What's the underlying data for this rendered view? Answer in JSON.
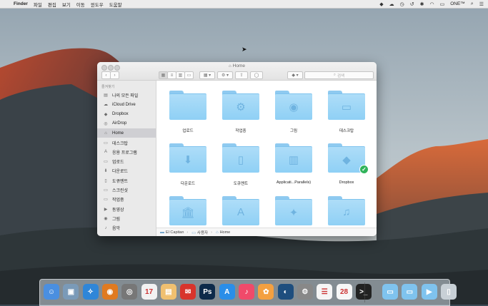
{
  "menubar": {
    "app_name": "Finder",
    "items": [
      "파일",
      "편집",
      "보기",
      "이동",
      "윈도우",
      "도움말"
    ],
    "right_label": "ONE™"
  },
  "window": {
    "title": "Home",
    "search_placeholder": "검색"
  },
  "sidebar": {
    "header": "즐겨찾기",
    "items": [
      {
        "label": "나의 모든 파일",
        "icon": "all-files-icon"
      },
      {
        "label": "iCloud Drive",
        "icon": "cloud-icon"
      },
      {
        "label": "Dropbox",
        "icon": "dropbox-icon"
      },
      {
        "label": "AirDrop",
        "icon": "airdrop-icon"
      },
      {
        "label": "Home",
        "icon": "home-icon",
        "selected": true
      },
      {
        "label": "데스크탑",
        "icon": "desktop-icon"
      },
      {
        "label": "응용 프로그램",
        "icon": "applications-icon"
      },
      {
        "label": "업로드",
        "icon": "folder-icon"
      },
      {
        "label": "다운로드",
        "icon": "download-icon"
      },
      {
        "label": "도큐멘트",
        "icon": "documents-icon"
      },
      {
        "label": "스크린샷",
        "icon": "folder-icon"
      },
      {
        "label": "작업중",
        "icon": "folder-icon"
      },
      {
        "label": "동영상",
        "icon": "movies-icon"
      },
      {
        "label": "그림",
        "icon": "pictures-icon"
      },
      {
        "label": "음악",
        "icon": "music-icon"
      }
    ]
  },
  "folders": [
    {
      "label": "업로드",
      "icon": "blank"
    },
    {
      "label": "작업중",
      "icon": "gear"
    },
    {
      "label": "그림",
      "icon": "camera"
    },
    {
      "label": "데스크탑",
      "icon": "window"
    },
    {
      "label": "다운로드",
      "icon": "download"
    },
    {
      "label": "도큐멘트",
      "icon": "document"
    },
    {
      "label": "Applicati...Parallels)",
      "icon": "stack"
    },
    {
      "label": "Dropbox",
      "icon": "dropbox",
      "synced": true
    },
    {
      "label": "",
      "icon": "library"
    },
    {
      "label": "",
      "icon": "apps"
    },
    {
      "label": "",
      "icon": "public"
    },
    {
      "label": "",
      "icon": "music"
    }
  ],
  "pathbar": {
    "items": [
      "El Capitan",
      "사용자",
      "Home"
    ]
  },
  "dock": {
    "items": [
      {
        "name": "finder",
        "color": "#4a8fe0",
        "glyph": "☺"
      },
      {
        "name": "preview",
        "color": "#7a9ab8",
        "glyph": "▣"
      },
      {
        "name": "safari",
        "color": "#2f86d8",
        "glyph": "✧"
      },
      {
        "name": "screaming",
        "color": "#e07a20",
        "glyph": "◉"
      },
      {
        "name": "scanner",
        "color": "#777777",
        "glyph": "◎"
      },
      {
        "name": "calendar-small",
        "color": "#f2f2f2",
        "glyph": "17"
      },
      {
        "name": "notes",
        "color": "#f0c070",
        "glyph": "▤"
      },
      {
        "name": "airmail",
        "color": "#d8342c",
        "glyph": "✉"
      },
      {
        "name": "photoshop",
        "color": "#0d2a4a",
        "glyph": "Ps"
      },
      {
        "name": "app-store",
        "color": "#2a8ee8",
        "glyph": "A"
      },
      {
        "name": "itunes",
        "color": "#f04a6a",
        "glyph": "♪"
      },
      {
        "name": "photos",
        "color": "#f4a040",
        "glyph": "✿"
      },
      {
        "name": "quicktime",
        "color": "#1e4e7e",
        "glyph": "◐"
      },
      {
        "name": "system-preferences",
        "color": "#888888",
        "glyph": "⚙"
      },
      {
        "name": "reminders",
        "color": "#f5f5f5",
        "glyph": "☰"
      },
      {
        "name": "calendar",
        "color": "#f7f7f7",
        "glyph": "28"
      },
      {
        "name": "terminal",
        "color": "#222222",
        "glyph": ">_"
      },
      {
        "name": "downloads-stack",
        "color": "#7fc3ee",
        "glyph": "▭"
      },
      {
        "name": "documents-stack",
        "color": "#7fc3ee",
        "glyph": "▭"
      },
      {
        "name": "apps-stack",
        "color": "#7fc3ee",
        "glyph": "▶"
      },
      {
        "name": "trash",
        "color": "#c8d0d6",
        "glyph": "▯"
      }
    ]
  }
}
